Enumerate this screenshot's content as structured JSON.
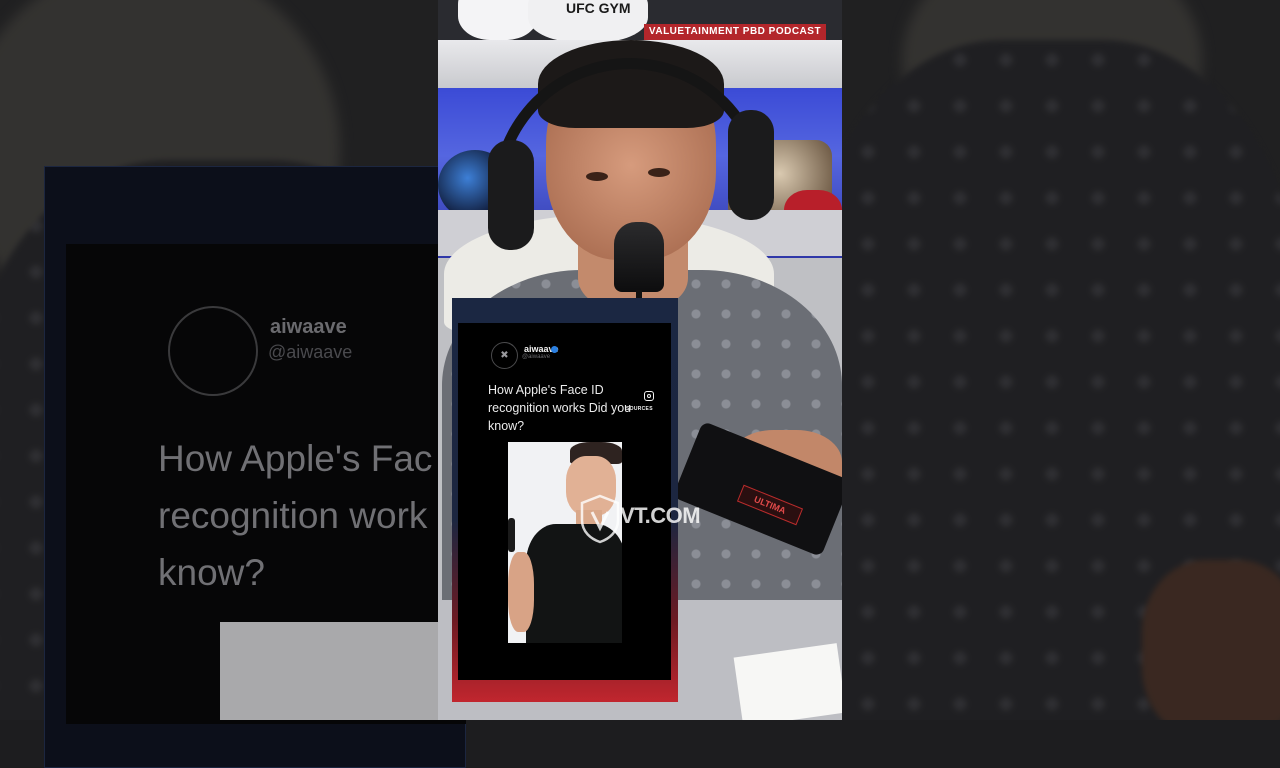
{
  "studio": {
    "gym_sign": "UFC GYM",
    "banner": "VALUETAINMENT  PBD PODCAST",
    "mic_brand": "ULTIMA"
  },
  "post": {
    "username": "aiwaave",
    "handle": "@aiwaave",
    "avatar_glyph": "✖",
    "verified_icon": "verified-badge-icon",
    "text": "How Apple's Face ID recognition works Did you know?",
    "sources_label": "SOURCES",
    "instagram_icon": "instagram-icon"
  },
  "watermark": {
    "text": "VT.COM"
  },
  "background_post": {
    "username": "aiwaave",
    "handle": "@aiwaave",
    "text_lines": [
      "How Apple's Fac",
      "recognition work",
      "know?"
    ]
  },
  "colors": {
    "card_frame_top": "#1c2640",
    "card_frame_bottom": "#c1262e",
    "verified": "#2a7fe0",
    "wall_blue": "#3b4bd6"
  }
}
